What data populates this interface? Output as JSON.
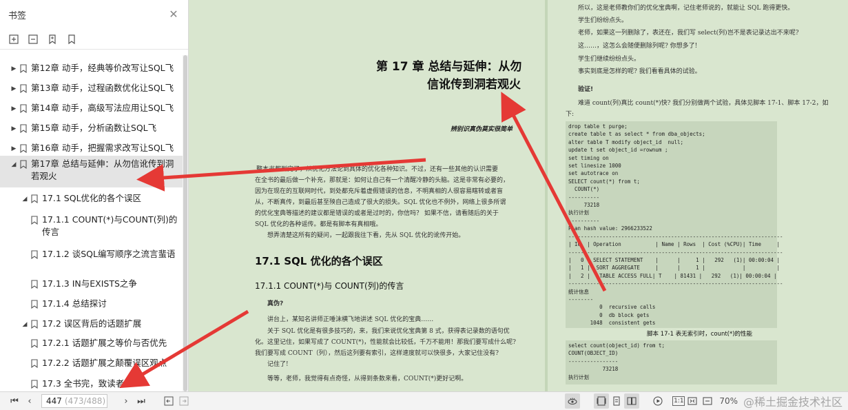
{
  "sidebar": {
    "title": "书签",
    "toc": [
      {
        "label": "第12章 动手，经典等价改写让SQL飞",
        "level": 0,
        "expanded": false
      },
      {
        "label": "第13章 动手，过程函数优化让SQL飞",
        "level": 0,
        "expanded": false
      },
      {
        "label": "第14章 动手，高级写法应用让SQL飞",
        "level": 0,
        "expanded": false
      },
      {
        "label": "第15章 动手，分析函数让SQL飞",
        "level": 0,
        "expanded": false
      },
      {
        "label": "第16章 动手，把握需求改写让SQL飞",
        "level": 0,
        "expanded": false
      },
      {
        "label": "第17章 总结与延伸：从勿信讹传到洞若观火",
        "level": 0,
        "expanded": true
      },
      {
        "label": "17.1 SQL优化的各个误区",
        "level": 1,
        "expanded": true
      },
      {
        "label": "17.1.1 COUNT(*)与COUNT(列)的传言",
        "level": 2
      },
      {
        "label": "17.1.2 谈SQL编写顺序之流言蜚语",
        "level": 2
      },
      {
        "label": "17.1.3 IN与EXISTS之争",
        "level": 2
      },
      {
        "label": "17.1.4 总结探讨",
        "level": 2
      },
      {
        "label": "17.2 误区背后的话题扩展",
        "level": 1,
        "expanded": true
      },
      {
        "label": "17.2.1 话题扩展之等价与否优先",
        "level": 2
      },
      {
        "label": "17.2.2 话题扩展之颠覆误区观点",
        "level": 2
      },
      {
        "label": "17.3 全书完，致读者",
        "level": 1
      }
    ]
  },
  "doc": {
    "left": {
      "chapter_line1": "第 17 章   总结与延伸：从勿",
      "chapter_line2": "信讹传到洞若观火",
      "motto": "辨别识真伪莫实很简单",
      "intro1": "整本书都到完了，从优化方法论到具体的优化各种知识。不过，还有一些其他的认识需要",
      "intro2": "在全书的最后做一个补充，那就是：如何让自己有一个清醒冷静的头脑。这是非常有必要的，",
      "intro3": "因为在现在的互联网时代，到处都充斥着虚假错误的信息，不明真相的人很容易瞎转或者盲",
      "intro4": "从，不断真传，到最后甚至殃自己造成了很大的损失。SQL 优化也不例外，网络上很多所谓",
      "intro5": "的优化宝典等描述的建议都是错误的或者是过时的，你信吗？ 如果不信，请看随后的关于",
      "intro6": "SQL 优化的各种谣传。都是有脚本有真相哦。",
      "intro7": "想弄清楚这所有的疑问，一起跟我往下看，先从 SQL 优化的讹传开始。",
      "h1": "17.1   SQL 优化的各个误区",
      "h2": "17.1.1    COUNT(*)与 COUNT(列)的传言",
      "sub": "真伪?",
      "p1": "讲台上，某知名讲师正唾沫横飞地讲述 SQL 优化的宝典……",
      "p2": "关于 SQL 优化是有很多技巧的，来，我们来说优化宝典第 8 式，获得表记录数的语句优",
      "p3": "化。这里记住，如果写成了 COUNT(*)，性能就会比较低，千万不能用！那我们要写成什么呢?",
      "p4": "我们要写成 COUNT（列），然后这列要有索引，这样速度就可以快很多，大家记住没有?",
      "p5": "记住了!",
      "p6": "等等，老师，我觉得有点奇怪，从得到条数来看，COUNT(*)更好记啊。"
    },
    "right": {
      "r1": "所以，这是老师教你们的优化宝典啊，记住老师说的，就能让 SQL 跑得更快。",
      "r2": "学生们纷纷点头。",
      "r3": "老师，如果这一列删除了，表还在，我们写 select(列)岂不是表记录达出不来呢?",
      "r4": "这……，这怎么会随便删除列呢? 你想多了!",
      "r5": "学生们继续纷纷点头。",
      "r6": "事实到底是怎样的呢? 我们看看具体的试验。",
      "verify": "验证!",
      "r7": "难道 count(列)真比 count(*)快? 我们分别做两个试验，具体见脚本 17-1、脚本 17-2，如",
      "r8": "下:",
      "code1": "drop table t purge;\ncreate table t as select * from dba_objects;\nalter table T modify object_id  null;\nupdate t set object_id =rownum ;\nset timing on\nset linesize 1000\nset autotrace on\nSELECT count(*) from t;\n  COUNT(*)\n----------\n     73218\n执行计划\n----------\nPlan hash value: 2966233522\n---------------------------------------------------------------------\n| Id  | Operation           | Name | Rows  | Cost (%CPU)| Time     |\n---------------------------------------------------------------------\n|   0 | SELECT STATEMENT    |      |     1 |   292   (1)| 00:00:04 |\n|   1 |  SORT AGGREGATE     |      |     1 |            |          |\n|   2 |   TABLE ACCESS FULL| T    | 81431 |   292   (1)| 00:00:04 |\n---------------------------------------------------------------------\n统计信息\n--------\n          0  recursive calls\n          0  db block gets\n       1048  consistent gets",
      "caption": "脚本 17-1   表无索引时，count(*)的性能",
      "code2": "select count(object_id) from t;\nCOUNT(OBJECT_ID)\n----------------\n           73218\n执行计划"
    }
  },
  "bottombar": {
    "page_current": "447",
    "page_total": "(473/488)",
    "zoom": "70%"
  },
  "watermark": "@稀土掘金技术社区"
}
